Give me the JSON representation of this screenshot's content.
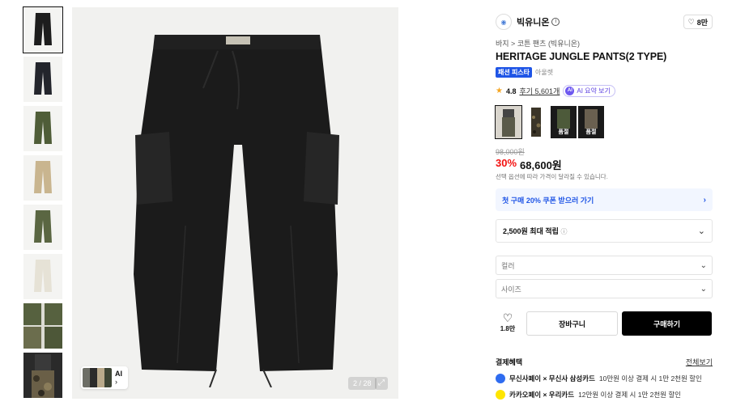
{
  "gallery": {
    "thumbnails": [
      {
        "color": "#1d1d1d",
        "name": "thumb-black"
      },
      {
        "color": "#23252c",
        "name": "thumb-navy"
      },
      {
        "color": "#4f5d38",
        "name": "thumb-olive"
      },
      {
        "color": "#c9b58f",
        "name": "thumb-beige"
      },
      {
        "color": "#5a6642",
        "name": "thumb-khaki"
      },
      {
        "color": "#e6e2d6",
        "name": "thumb-ivory"
      },
      {
        "color": "#56613f",
        "name": "thumb-model-olive"
      },
      {
        "color": "#3f3b34",
        "name": "thumb-model-camo"
      }
    ],
    "counter": "2 / 28",
    "ai_chip_label": "AI",
    "ai_chip_arrow": "›"
  },
  "brand": {
    "name": "빅유니온",
    "likes": "8만"
  },
  "breadcrumb": "바지 > 코튼 팬츠 (빅유니온)",
  "product": {
    "title": "HERITAGE JUNGLE PANTS(2 TYPE)",
    "badge": "패션 피스타",
    "badge_sub": "아울렛",
    "rating": "4.8",
    "reviews": "후기 5,601개",
    "ai_summary": "AI 요약 보기",
    "ai_dot": "AI",
    "original_price": "98,000원",
    "discount": "30%",
    "price": "68,600원",
    "price_note": "선택 옵션에 따라 가격이 달라질 수 있습니다."
  },
  "swatches": [
    {
      "tag": "",
      "name": "swatch-1"
    },
    {
      "tag": "",
      "name": "swatch-2"
    },
    {
      "tag": "품절",
      "name": "swatch-3"
    },
    {
      "tag": "품절",
      "name": "swatch-4"
    }
  ],
  "coupon": {
    "label": "첫 구매 20% 쿠폰 받으러 가기",
    "arrow": "›"
  },
  "points": {
    "label": "2,500원 최대 적립",
    "info": "ⓘ"
  },
  "options": {
    "color_placeholder": "컬러",
    "size_placeholder": "사이즈",
    "chevron": "⌄"
  },
  "actions": {
    "wish_count": "1.8만",
    "heart": "♡",
    "cart": "장바구니",
    "buy": "구매하기"
  },
  "benefits": {
    "title": "결제혜택",
    "more": "전체보기",
    "items": [
      {
        "strong": "무신사페이 × 무신사 삼성카드",
        "text": "10만원 이상 결제 시 1만 2천원 할인",
        "color": "#2f6cf0"
      },
      {
        "strong": "카카오페이 × 우리카드",
        "text": "12만원 이상 결제 시 1만 2천원 할인",
        "color": "#fee500"
      }
    ]
  },
  "colors": {
    "accent_blue": "#1f55e6",
    "discount_red": "#f31110",
    "buy_black": "#000000"
  }
}
